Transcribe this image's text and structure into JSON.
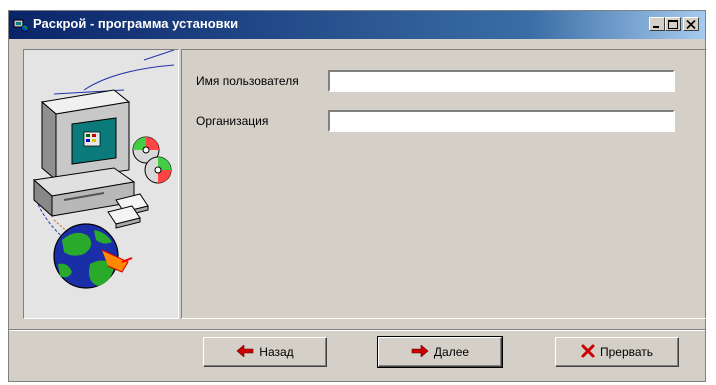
{
  "window": {
    "title": "Раскрой - программа установки"
  },
  "form": {
    "username": {
      "label": "Имя пользователя",
      "value": ""
    },
    "organization": {
      "label": "Организация",
      "value": ""
    }
  },
  "buttons": {
    "back": "Назад",
    "next": "Далее",
    "cancel": "Прервать"
  },
  "icons": {
    "app": "setup-icon",
    "back": "red-arrow-left-icon",
    "next": "red-arrow-right-icon",
    "cancel": "red-x-icon"
  },
  "colors": {
    "titlebar_start": "#0a246a",
    "titlebar_end": "#a6caf0",
    "face": "#d4d0c8",
    "arrow": "#cc0000"
  }
}
